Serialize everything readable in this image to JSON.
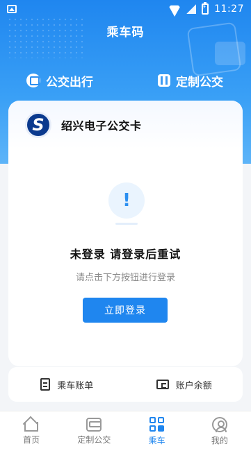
{
  "status_bar": {
    "time": "11:27",
    "icons": [
      "gallery-icon",
      "wifi-icon",
      "signal-icon",
      "battery-icon"
    ]
  },
  "header": {
    "title": "乘车码"
  },
  "tabs": [
    {
      "label": "公交出行",
      "icon": "bus-icon",
      "active": true
    },
    {
      "label": "定制公交",
      "icon": "custom-bus-icon",
      "active": false
    }
  ],
  "card": {
    "name": "绍兴电子公交卡",
    "logo_letter": "S",
    "alert_symbol": "!",
    "status_title": "未登录 请登录后重试",
    "status_subtitle": "请点击下方按钮进行登录",
    "login_button": "立即登录"
  },
  "actions": [
    {
      "label": "乘车账单",
      "icon": "receipt-icon"
    },
    {
      "label": "账户余额",
      "icon": "wallet-icon"
    }
  ],
  "bottom_nav": [
    {
      "label": "首页",
      "icon": "home-icon",
      "active": false
    },
    {
      "label": "定制公交",
      "icon": "bus-icon",
      "active": false
    },
    {
      "label": "乘车",
      "icon": "qr-code-icon",
      "active": true
    },
    {
      "label": "我的",
      "icon": "profile-icon",
      "active": false
    }
  ],
  "colors": {
    "primary": "#1f86ef",
    "header_gradient_top": "#1f86ef",
    "header_gradient_bottom": "#5db4f8",
    "page_bg": "#f3f5f8"
  }
}
